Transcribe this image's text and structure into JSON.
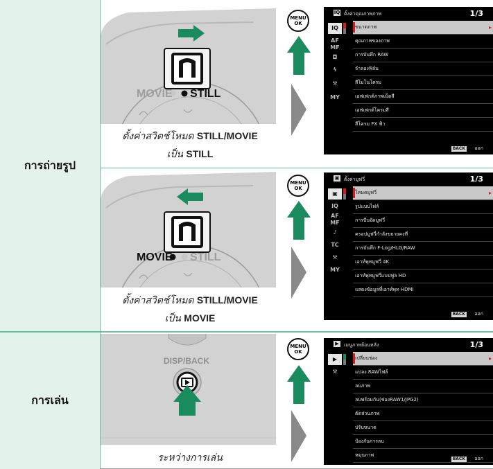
{
  "rows": [
    {
      "category": "การถ่ายรูป",
      "caption_line1_prefix": "ตั้งค่าสวิตช์โหมด ",
      "caption_line1_bold": "STILL/MOVIE",
      "caption_line2_prefix": "เป็น ",
      "caption_line2_bold": "STILL",
      "switch_labels": {
        "movie": "MOVIE",
        "still": "STILL"
      },
      "menu_button": {
        "top": "MENU",
        "bottom": "OK"
      },
      "screen": {
        "tab_icon": "I.Q.",
        "title": "ตั้งค่าคุณภาพภาพ",
        "page": "1/3",
        "side_selected": "I.Q.",
        "side_items": [
          "AF MF",
          "camera-icon",
          "flash-icon",
          "wrench-icon",
          "MY"
        ],
        "items": [
          "ขนาดภาพ",
          "คุณภาพของภาพ",
          "การบันทึก RAW",
          "จำลองฟิล์ม",
          "สีโมโนโครม",
          "เอฟเฟกต์ภาพเม็ดสี",
          "เอฟเฟกต์โครมสี",
          "สีโครม FX ฟ้า"
        ],
        "back_key": "BACK",
        "back_label": "ออก"
      }
    },
    {
      "caption_line1_prefix": "ตั้งค่าสวิตช์โหมด ",
      "caption_line1_bold": "STILL/MOVIE",
      "caption_line2_prefix": "เป็น ",
      "caption_line2_bold": "MOVIE",
      "switch_labels": {
        "movie": "MOVIE",
        "still": "STILL"
      },
      "menu_button": {
        "top": "MENU",
        "bottom": "OK"
      },
      "screen": {
        "tab_icon": "movie-icon",
        "title": "ตั้งค่ามูฟวี่",
        "page": "1/3",
        "side_selected": "movie-icon",
        "side_items": [
          "I.Q.",
          "AF MF",
          "mic-icon",
          "TC",
          "wrench-icon",
          "MY"
        ],
        "items": [
          "โหมดมูฟวี่",
          "รูปแบบไฟล์",
          "การบีบอัดมูฟวี่",
          "ครอปมูฟวี่กำลังขยายคงที่",
          "การบันทึก F-Log/HLG/RAW",
          "เอาท์พุทมูฟวี่ 4K",
          "เอาท์พุทมูฟวี่แบบฟูล HD",
          "แสดงข้อมูลที่เอาท์พุท HDMI"
        ],
        "back_key": "BACK",
        "back_label": "ออก"
      }
    },
    {
      "category": "การเล่น",
      "caption": "ระหว่างการเล่น",
      "button_label": "DISP/BACK",
      "menu_button": {
        "top": "MENU",
        "bottom": "OK"
      },
      "screen": {
        "tab_icon": "play-icon",
        "title": "เมนูภาพย้อนหลัง",
        "page": "1/3",
        "side_selected": "play-icon",
        "side_items": [
          "wrench-icon"
        ],
        "items": [
          "เปลี่ยนช่อง",
          "แปลง RAWไฟล์",
          "ลบภาพ",
          "ลบพร้อมกัน(ช่องRAW1/JPG2)",
          "ตัดส่วนภาพ",
          "ปรับขนาด",
          "ป้องกันการลบ",
          "หมุนภาพ"
        ],
        "back_key": "BACK",
        "back_label": "ออก"
      }
    }
  ],
  "colors": {
    "category_bg": "#e4f2ec",
    "divider": "#6cbf9e",
    "arrow_green": "#1a8a5f",
    "play_arrow_gray": "#8a8a8a",
    "highlight_red": "#d31c1c"
  }
}
